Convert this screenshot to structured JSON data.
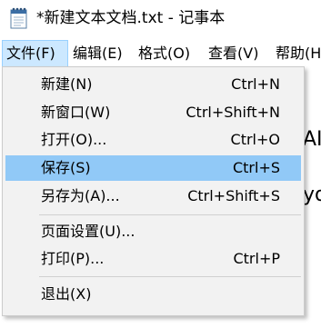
{
  "window": {
    "title": "*新建文本文档.txt - 记事本",
    "icon": "notepad-icon"
  },
  "menubar": {
    "items": [
      {
        "label": "文件(F)",
        "active": true
      },
      {
        "label": "编辑(E)"
      },
      {
        "label": "格式(O)"
      },
      {
        "label": "查看(V)"
      },
      {
        "label": "帮助(H"
      }
    ]
  },
  "editor": {
    "visible_text": [
      "AI",
      "yo"
    ]
  },
  "file_menu": {
    "items": [
      {
        "label": "新建(N)",
        "shortcut": "Ctrl+N"
      },
      {
        "label": "新窗口(W)",
        "shortcut": "Ctrl+Shift+N"
      },
      {
        "label": "打开(O)...",
        "shortcut": "Ctrl+O"
      },
      {
        "label": "保存(S)",
        "shortcut": "Ctrl+S",
        "highlighted": true
      },
      {
        "label": "另存为(A)...",
        "shortcut": "Ctrl+Shift+S"
      },
      {
        "label": "页面设置(U)...",
        "shortcut": ""
      },
      {
        "label": "打印(P)...",
        "shortcut": "Ctrl+P"
      },
      {
        "label": "退出(X)",
        "shortcut": ""
      }
    ]
  },
  "colors": {
    "menu_background": "#f2f2f2",
    "highlight": "#91c9f7",
    "menubar_active": "#cce8ff"
  }
}
